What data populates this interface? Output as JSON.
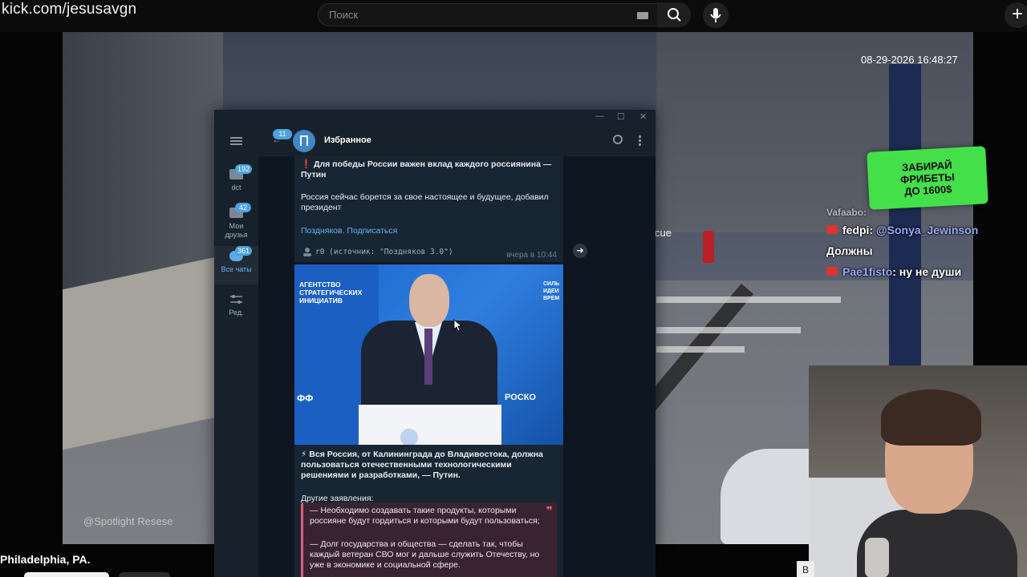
{
  "browser": {
    "url": "kick.com/jesusavgn",
    "search_placeholder": "Поиск"
  },
  "stream": {
    "timestamp": "08-29-2026 16:48:27",
    "watermark": "@Spotlight Resese",
    "partial_text": "cue",
    "location": "Philadelphia, PA.",
    "promo_text": "ЗАБИРАЙ\nФРИБЕТЫ\nДО 1600$",
    "chat": [
      {
        "user": "Vafaabo",
        "text": ":"
      },
      {
        "user": "fedpi",
        "text": ":",
        "mention": "@Sonya_Jewinson"
      },
      {
        "user": "",
        "text": "Должны"
      },
      {
        "user": "Pae1fisto",
        "text": ": ну не души"
      }
    ],
    "partial_button": "B"
  },
  "telegram": {
    "chat_title": "Избранное",
    "back_badge": "11",
    "folders": [
      {
        "label": "dct",
        "badge": "192"
      },
      {
        "label": "Мои друзья",
        "badge": "42"
      },
      {
        "label": "Все чаты",
        "badge": "361"
      },
      {
        "label": "Ред.",
        "badge": ""
      }
    ],
    "message1": {
      "headline": "❗ Для победы России важен вклад каждого россиянина — Путин",
      "body": "Россия сейчас борется за свое настоящее и будущее, добавил президент",
      "link": "Поздняков. Подписаться",
      "source": "r0 (источник: \"Поздняков 3.0\")",
      "time": "вчера в 10:44"
    },
    "photo": {
      "left_logo": "АГЕНТСТВО\nСТРАТЕГИЧЕСКИХ\nИНИЦИАТИВ",
      "right_logo": "РОСКО",
      "right_top": "СИЛЬ\nИДЕИ\nВРЕМ",
      "left_bottom": "ФФ"
    },
    "message2": {
      "headline": "⚡ Вся Россия, от Калининграда до Владивостока, должна пользоваться отечественными технологическими решениями и разработками, — Путин.",
      "subhead": "Другие заявления:",
      "quote1": "— Необходимо создавать такие продукты, которыми россияне будут гордиться и которыми будут пользоваться;",
      "quote2": "— Долг государства и общества — сделать так, чтобы каждый ветеран СВО мог и дальше служить Отечеству, но уже в экономике и социальной сфере."
    }
  }
}
